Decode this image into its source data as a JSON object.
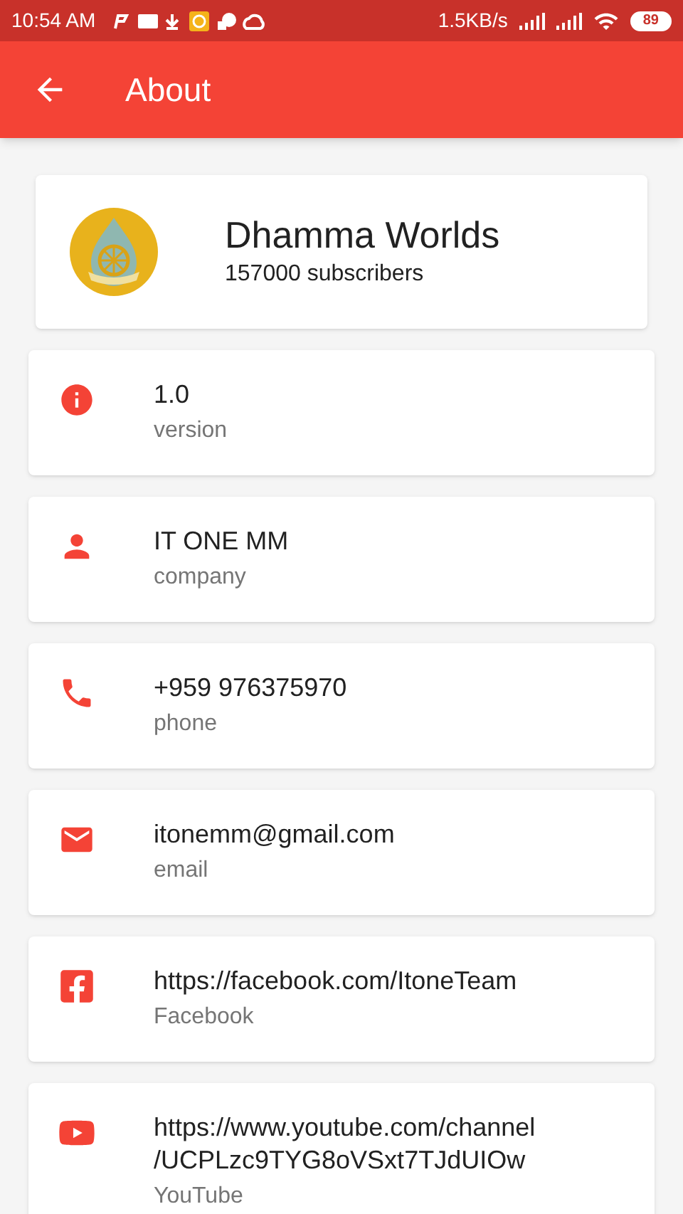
{
  "status_bar": {
    "time": "10:54 AM",
    "speed": "1.5KB/s",
    "battery": "89"
  },
  "app_bar": {
    "title": "About"
  },
  "channel": {
    "name": "Dhamma Worlds",
    "subscribers": "157000 subscribers"
  },
  "items": [
    {
      "kind": "info",
      "lines": [
        "1.0"
      ],
      "label": "version"
    },
    {
      "kind": "person",
      "lines": [
        "IT ONE MM"
      ],
      "label": "company"
    },
    {
      "kind": "phone",
      "lines": [
        "+959 976375970"
      ],
      "label": "phone"
    },
    {
      "kind": "email",
      "lines": [
        "itonemm@gmail.com"
      ],
      "label": "email"
    },
    {
      "kind": "facebook",
      "lines": [
        "https://facebook.com/ItoneTeam"
      ],
      "label": "Facebook"
    },
    {
      "kind": "youtube",
      "lines": [
        "https://www.youtube.com/channel",
        "/UCPLzc9TYG8oVSxt7TJdUIOw"
      ],
      "label": "YouTube"
    }
  ]
}
